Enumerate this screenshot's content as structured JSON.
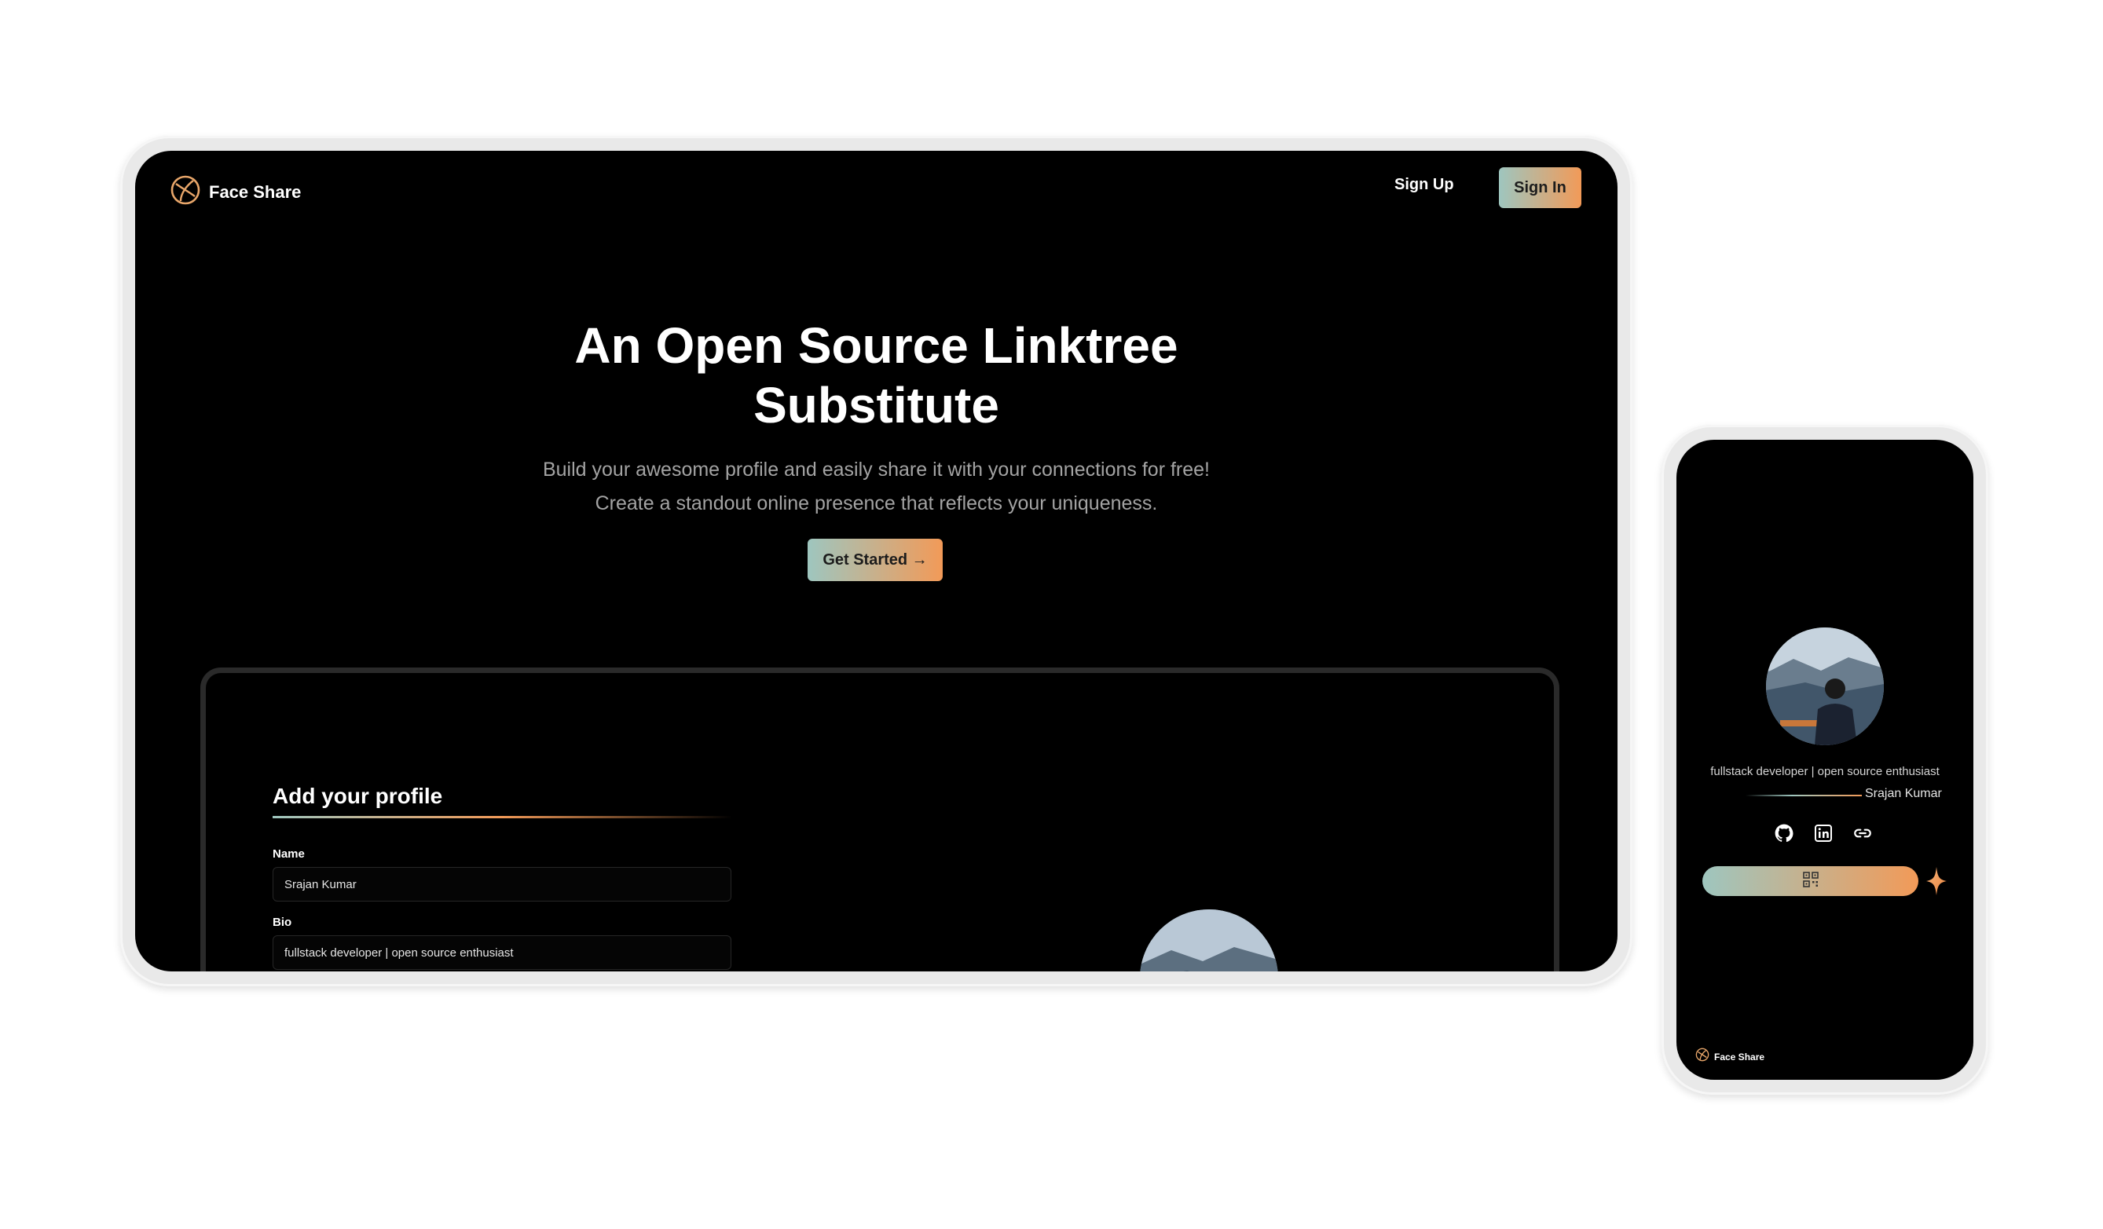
{
  "nav": {
    "brand": "Face Share",
    "signup_label": "Sign Up",
    "signin_label": "Sign In"
  },
  "hero": {
    "title_line1": "An Open Source Linktree",
    "title_line2": "Substitute",
    "subtitle_line1": "Build your awesome profile and easily share it with your connections for free!",
    "subtitle_line2": "Create a standout online presence that reflects your uniqueness.",
    "cta_label": "Get Started →"
  },
  "profile_form": {
    "heading": "Add your profile",
    "name_label": "Name",
    "name_value": "Srajan Kumar",
    "bio_label": "Bio",
    "bio_value": "fullstack developer | open source enthusiast"
  },
  "phone": {
    "bio": "fullstack developer | open source enthusiast",
    "name": "Srajan Kumar",
    "icons": [
      "github-icon",
      "linkedin-icon",
      "link-icon"
    ],
    "qr_icon": "qr-code-icon",
    "sparkle_icon": "sparkle-icon",
    "footer_brand": "Face Share"
  },
  "colors": {
    "accent_start": "#9ec6bf",
    "accent_end": "#f29a58",
    "background": "#000000",
    "muted_text": "#a3a3a3"
  }
}
